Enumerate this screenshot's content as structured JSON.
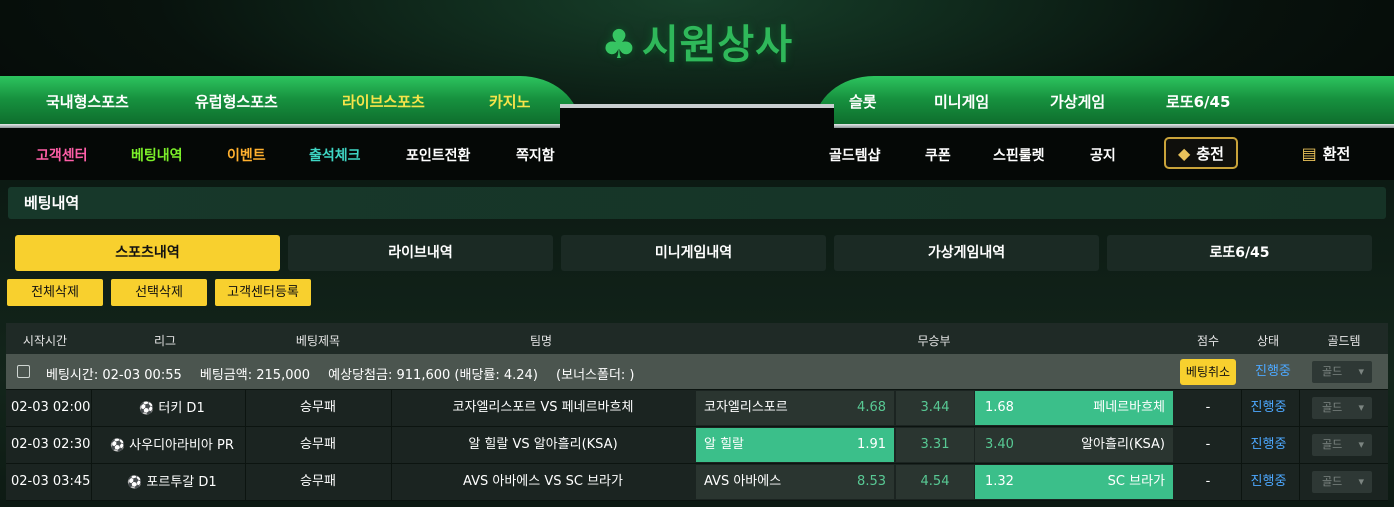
{
  "brand": {
    "logo_text": "시원상사"
  },
  "main_nav": [
    "국내형스포츠",
    "유럽형스포츠",
    "라이브스포츠",
    "카지노",
    "슬롯",
    "미니게임",
    "가상게임",
    "로또6/45"
  ],
  "sub_nav": [
    "고객센터",
    "베팅내역",
    "이벤트",
    "출석체크",
    "포인트전환",
    "쪽지함",
    "골드템샵",
    "쿠폰",
    "스핀룰렛",
    "공지"
  ],
  "cash_buttons": {
    "charge": "충전",
    "exchange": "환전"
  },
  "page_title": "베팅내역",
  "tabs": [
    "스포츠내역",
    "라이브내역",
    "미니게임내역",
    "가상게임내역",
    "로또6/45"
  ],
  "actions": [
    "전체삭제",
    "선택삭제",
    "고객센터등록"
  ],
  "table": {
    "headers": [
      "시작시간",
      "리그",
      "베팅제목",
      "팀명",
      "무승부",
      "점수",
      "상태",
      "골드템"
    ],
    "bet_info": {
      "time_label": "베팅시간:",
      "time": "02-03 00:55",
      "amount_label": "베팅금액:",
      "amount": "215,000",
      "expected_label": "예상당첨금:",
      "expected": "911,600",
      "rate": "(배당률: 4.24)",
      "bonus": "(보너스폴더: )",
      "cancel": "베팅취소",
      "status": "진행중",
      "gold": "골드"
    },
    "rows": [
      {
        "time": "02-03 02:00",
        "league": "터키 D1",
        "bet_type": "승무패",
        "match": "코자엘리스포르 VS 페네르바흐체",
        "home": "코자엘리스포르",
        "home_odds": "4.68",
        "draw": "3.44",
        "away": "페네르바흐체",
        "away_odds": "1.68",
        "selected": "away",
        "score": "-",
        "status": "진행중",
        "gold": "골드"
      },
      {
        "time": "02-03 02:30",
        "league": "사우디아라비아 PR",
        "bet_type": "승무패",
        "match": "알 힐랄 VS 알아흘리(KSA)",
        "home": "알 힐랄",
        "home_odds": "1.91",
        "draw": "3.31",
        "away": "알아흘리(KSA)",
        "away_odds": "3.40",
        "selected": "home",
        "score": "-",
        "status": "진행중",
        "gold": "골드"
      },
      {
        "time": "02-03 03:45",
        "league": "포르투갈 D1",
        "bet_type": "승무패",
        "match": "AVS 아바에스 VS SC 브라가",
        "home": "AVS 아바에스",
        "home_odds": "8.53",
        "draw": "4.54",
        "away": "SC 브라가",
        "away_odds": "1.32",
        "selected": "away",
        "score": "-",
        "status": "진행중",
        "gold": "골드"
      }
    ]
  }
}
